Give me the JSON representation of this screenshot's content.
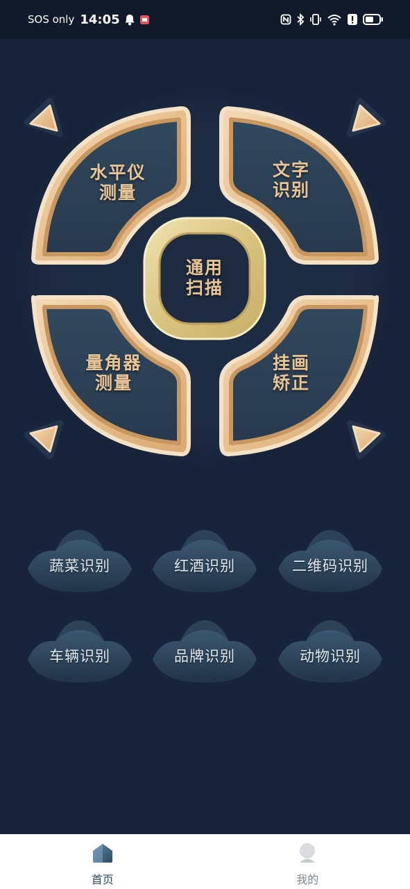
{
  "status_bar": {
    "carrier": "SOS only",
    "time": "14:05",
    "icons": [
      "bell-icon",
      "app-notification-icon",
      "nfc-icon",
      "bluetooth-icon",
      "vibrate-icon",
      "wifi-icon",
      "alert-icon",
      "battery-icon"
    ]
  },
  "dial": {
    "top_left": "水平仪\n测量",
    "top_right": "文字\n识别",
    "center": "通用\n扫描",
    "bottom_left": "量角器\n测量",
    "bottom_right": "挂画\n矫正"
  },
  "recognition": [
    "蔬菜识别",
    "红酒识别",
    "二维码识别",
    "车辆识别",
    "品牌识别",
    "动物识别"
  ],
  "nav": {
    "home": "首页",
    "mine": "我的"
  },
  "colors": {
    "background": "#18243a",
    "gold": "#e9c596",
    "panel": "#2c4256"
  }
}
